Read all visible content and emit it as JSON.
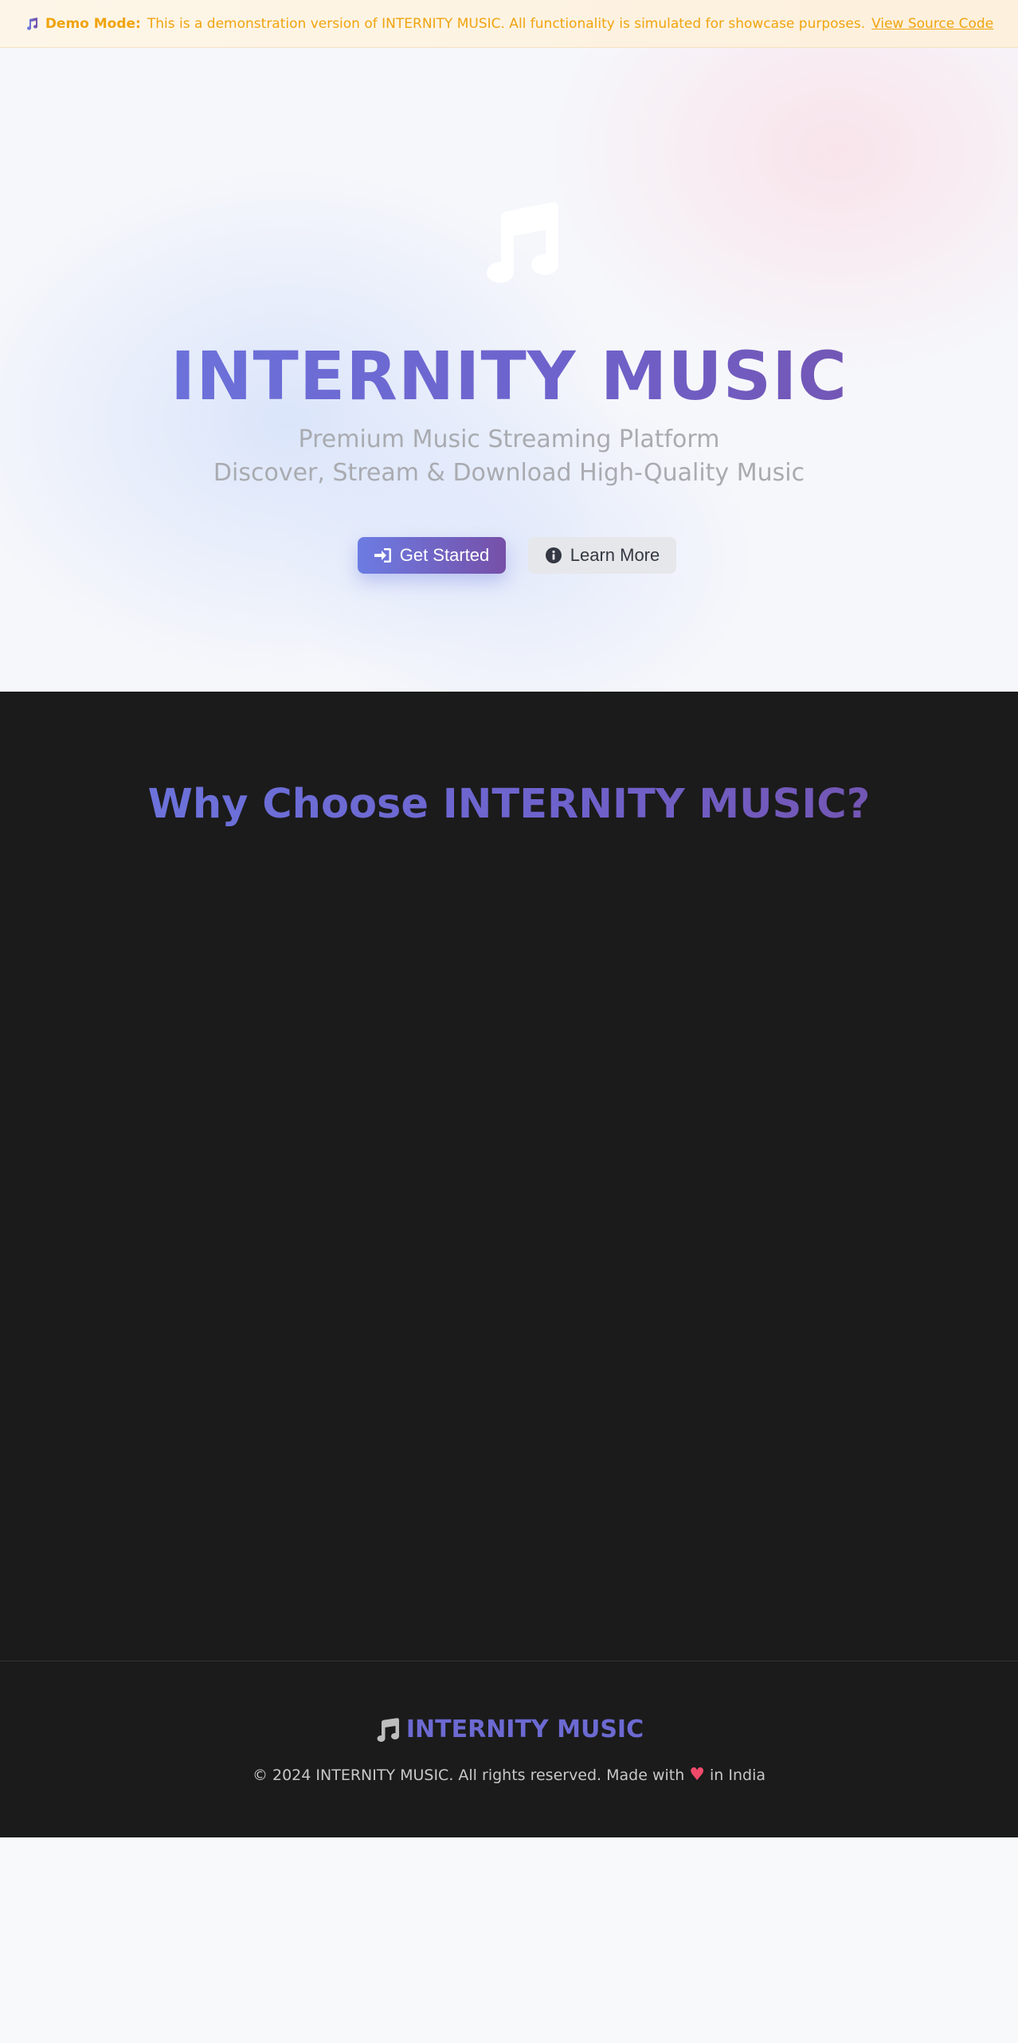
{
  "banner": {
    "label": "Demo Mode:",
    "message": "This is a demonstration version of INTERNITY MUSIC. All functionality is simulated for showcase purposes.",
    "link_text": "View Source Code",
    "icon": "music-note-icon"
  },
  "hero": {
    "icon": "music-note-icon",
    "title": "INTERNITY MUSIC",
    "subtitle_line1": "Premium Music Streaming Platform",
    "subtitle_line2": "Discover, Stream & Download High-Quality Music",
    "primary_button": {
      "label": "Get Started",
      "icon": "sign-in-icon"
    },
    "secondary_button": {
      "label": "Learn More",
      "icon": "info-circle-icon"
    }
  },
  "features": {
    "title": "Why Choose INTERNITY MUSIC?"
  },
  "footer": {
    "brand": "INTERNITY MUSIC",
    "copyright_prefix": "© 2024 INTERNITY MUSIC. All rights reserved. Made with",
    "heart": "♥",
    "copyright_suffix": "in India"
  },
  "colors": {
    "accent_start": "#6c7ce3",
    "accent_end": "#7650a8",
    "banner_text": "#f0a40f",
    "dark_bg": "#1b1b1b"
  }
}
